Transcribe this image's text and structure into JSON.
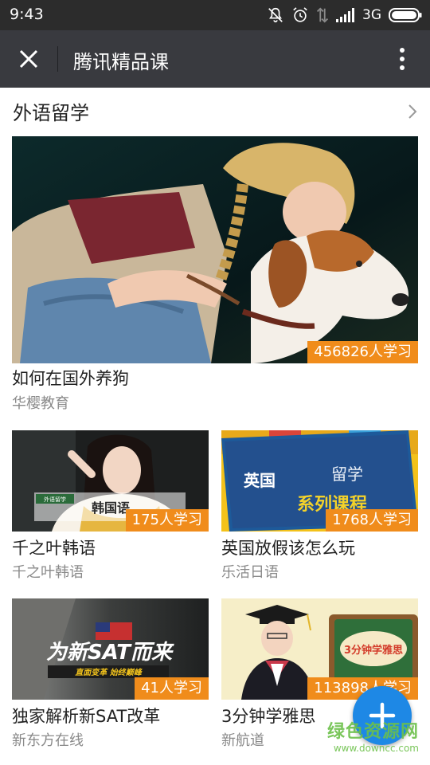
{
  "status_bar": {
    "time": "9:43",
    "network": "3G"
  },
  "app_bar": {
    "title": "腾讯精品课"
  },
  "section": {
    "title": "外语留学"
  },
  "featured": {
    "title": "如何在国外养狗",
    "org": "华樱教育",
    "learners": "456826人学习"
  },
  "courses": [
    {
      "title": "千之叶韩语",
      "org": "千之叶韩语",
      "learners": "175人学习",
      "thumb_text": "韩国语",
      "thumb_tag": "外语留学"
    },
    {
      "title": "英国放假该怎么玩",
      "org": "乐活日语",
      "learners": "1768人学习",
      "thumb_text_a": "英国",
      "thumb_text_b": "留学",
      "thumb_text_c": "系列课程"
    },
    {
      "title": "独家解析新SAT改革",
      "org": "新东方在线",
      "learners": "41人学习",
      "thumb_text": "为新SAT而来",
      "thumb_sub": "直面变革 始终巅峰"
    },
    {
      "title": "3分钟学雅思",
      "org": "新航道",
      "learners": "113898人学习",
      "thumb_text": "3分钟学雅思"
    }
  ],
  "watermark": {
    "text": "绿色资源网",
    "url": "www.downcc.com"
  },
  "colors": {
    "status_bar": "#2c2c2c",
    "app_bar": "#393a3f",
    "badge": "#f08c1b",
    "fab": "#1e88e5"
  }
}
